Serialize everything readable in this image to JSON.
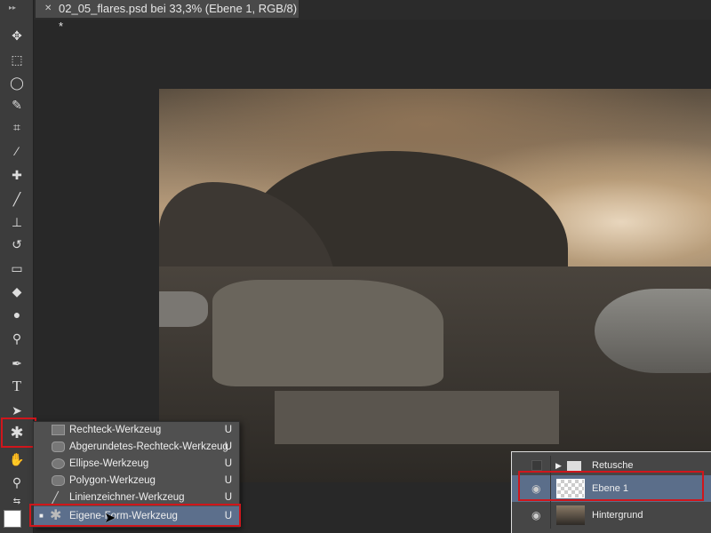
{
  "document_tab": {
    "title": "02_05_flares.psd bei 33,3% (Ebene 1, RGB/8) *",
    "close_icon": "close-icon"
  },
  "toolbar": {
    "tools": [
      "move-tool",
      "marquee-tool",
      "lasso-tool",
      "quick-selection-tool",
      "crop-tool",
      "eyedropper-tool",
      "healing-brush-tool",
      "brush-tool",
      "clone-stamp-tool",
      "history-brush-tool",
      "eraser-tool",
      "paint-bucket-tool",
      "burn-tool",
      "dodge-tool",
      "pen-tool",
      "type-tool",
      "path-selection-tool",
      "custom-shape-tool",
      "hand-tool",
      "zoom-tool"
    ]
  },
  "shape_menu": {
    "items": [
      {
        "label": "Rechteck-Werkzeug",
        "key": "U",
        "icon": "rectangle-icon"
      },
      {
        "label": "Abgerundetes-Rechteck-Werkzeug",
        "key": "U",
        "icon": "rounded-rectangle-icon"
      },
      {
        "label": "Ellipse-Werkzeug",
        "key": "U",
        "icon": "ellipse-icon"
      },
      {
        "label": "Polygon-Werkzeug",
        "key": "U",
        "icon": "polygon-icon"
      },
      {
        "label": "Linienzeichner-Werkzeug",
        "key": "U",
        "icon": "line-icon"
      },
      {
        "label": "Eigene-Form-Werkzeug",
        "key": "U",
        "icon": "custom-shape-icon",
        "selected": true
      }
    ]
  },
  "layers": [
    {
      "name": "Retusche",
      "type": "group",
      "visible": false
    },
    {
      "name": "Ebene 1",
      "type": "layer",
      "visible": true,
      "selected": true
    },
    {
      "name": "Hintergrund",
      "type": "layer",
      "visible": true
    }
  ],
  "colors": {
    "highlight": "#d0161c",
    "selection": "#5c6f8c"
  }
}
